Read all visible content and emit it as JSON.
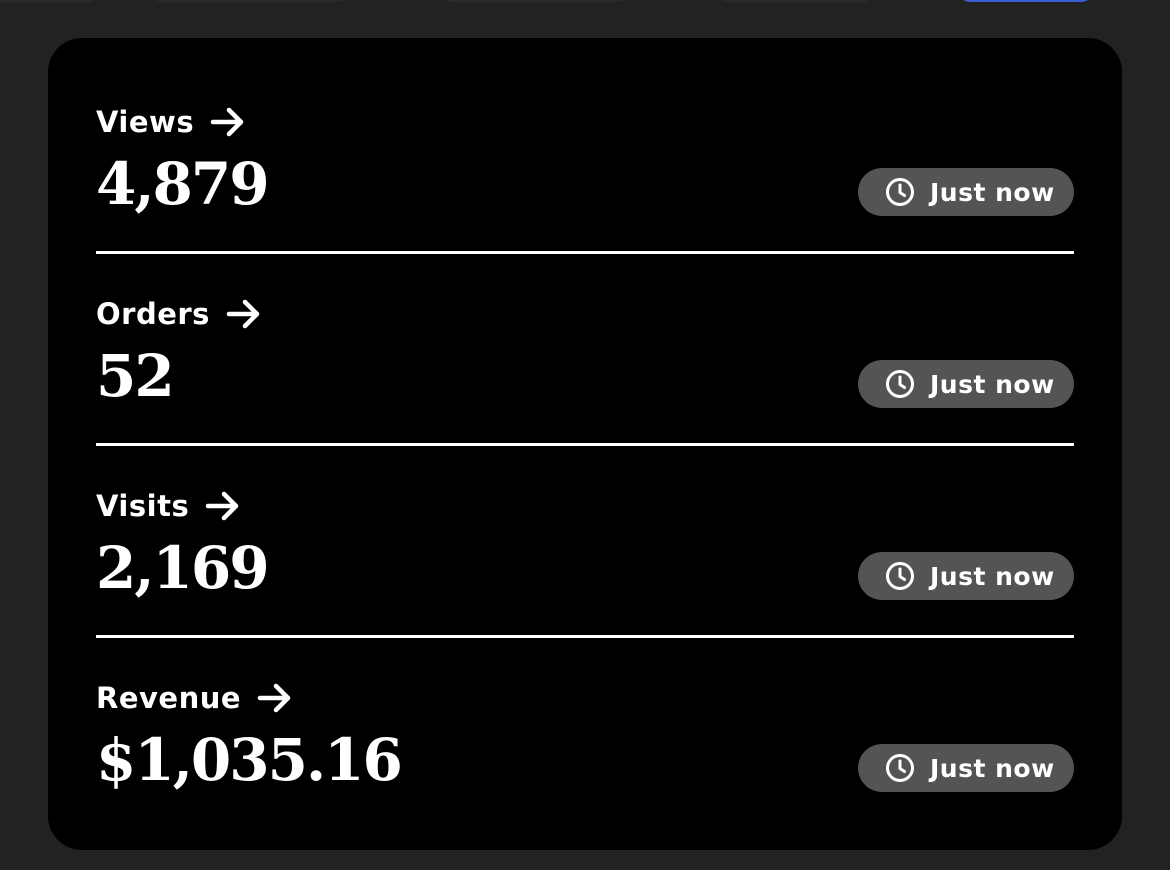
{
  "metrics": [
    {
      "label": "Views",
      "value": "4,879",
      "updated": "Just now"
    },
    {
      "label": "Orders",
      "value": "52",
      "updated": "Just now"
    },
    {
      "label": "Visits",
      "value": "2,169",
      "updated": "Just now"
    },
    {
      "label": "Revenue",
      "value": "$1,035.16",
      "updated": "Just now"
    }
  ],
  "icons": {
    "arrow": "arrow-right-icon",
    "clock": "clock-icon"
  },
  "colors": {
    "page_background": "#222222",
    "card_background": "#000000",
    "badge_background": "#545454",
    "active_tab": "#3a5fd0"
  }
}
